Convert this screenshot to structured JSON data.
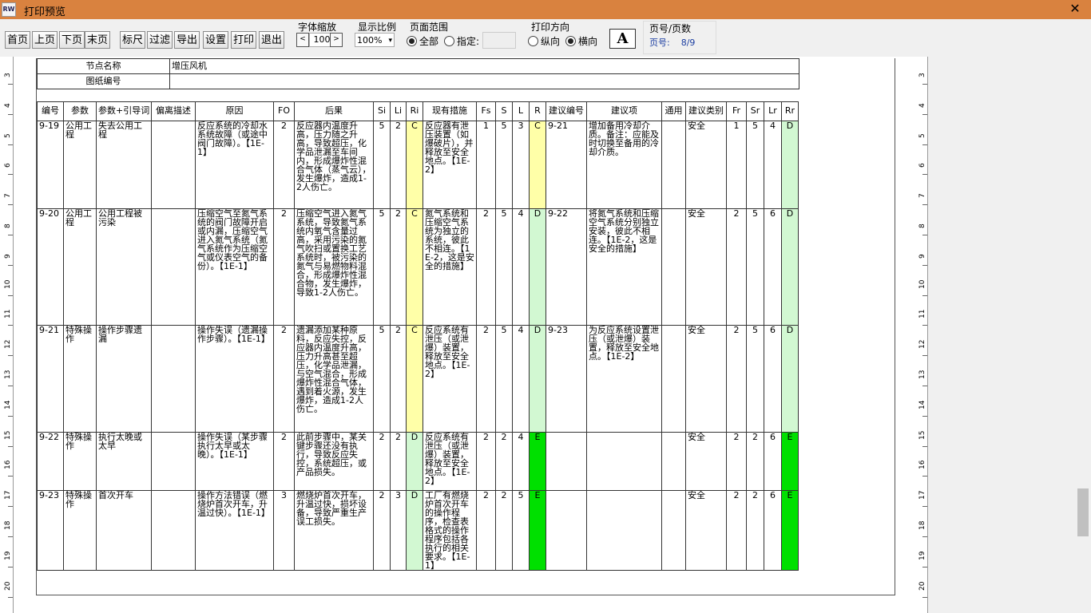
{
  "window": {
    "title": "打印预览",
    "icon": "preview-icon",
    "close": "✕"
  },
  "toolbar": {
    "nav": [
      "首页",
      "上页",
      "下页",
      "末页"
    ],
    "tools": [
      "标尺",
      "过滤",
      "导出",
      "设置",
      "打印",
      "退出"
    ],
    "font_zoom": {
      "label": "字体缩放",
      "value": "100",
      "dec": "<",
      "inc": ">"
    },
    "scale": {
      "label": "显示比例",
      "value": "100%"
    },
    "range": {
      "label": "页面范围",
      "all": "全部",
      "specify": "指定:"
    },
    "orientation": {
      "label": "打印方向",
      "portrait": "纵向",
      "landscape": "横向",
      "selected": "landscape"
    },
    "font_button": "A",
    "page": {
      "label": "页号/页数",
      "prefix": "页号:",
      "value": "8/9"
    }
  },
  "ruler": {
    "left_numbers": [
      "3",
      "4",
      "5",
      "6",
      "7",
      "8",
      "9",
      "10",
      "11",
      "12",
      "13",
      "14",
      "15",
      "16",
      "17",
      "18",
      "19",
      "20"
    ]
  },
  "header": [
    {
      "label": "节点名称",
      "value": "增压风机"
    },
    {
      "label": "图纸编号",
      "value": ""
    }
  ],
  "columns": [
    "编号",
    "参数",
    "参数+引导词",
    "偏离描述",
    "原因",
    "FO",
    "后果",
    "Si",
    "Li",
    "Ri",
    "现有措施",
    "Fs",
    "S",
    "L",
    "R",
    "建议编号",
    "建议项",
    "通用",
    "建议类别",
    "Fr",
    "Sr",
    "Lr",
    "Rr"
  ],
  "colors": {
    "yellow": "#ffffa8",
    "light_green": "#d2f8d2",
    "green": "#00e000"
  },
  "rows": [
    {
      "id": "9-19",
      "param": "公用工程",
      "guide": "失去公用工程",
      "dev": "",
      "cause": "反应系统的冷却水系统故障（或途中阀门故障）。【1E-1】",
      "fo": "2",
      "consequence": "反应器内温度升高，压力随之升高，导致超压，化学品泄漏至车间内，形成爆炸性混合气体（蒸气云），发生爆炸，造成1-2人伤亡。",
      "si": "5",
      "li": "2",
      "ri": "C",
      "measures": "反应器有泄压装置（如爆破片），并释放至安全地点。【1E-2】",
      "fs": "1",
      "s": "5",
      "l": "3",
      "r": "C",
      "sug_id": "9-21",
      "suggestion": "增加备用冷却介质。备注：应能及时切换至备用的冷却介质。",
      "general": "",
      "category": "安全",
      "fr": "1",
      "sr": "5",
      "lr": "4",
      "rr": "D"
    },
    {
      "id": "9-20",
      "param": "公用工程",
      "guide": "公用工程被污染",
      "dev": "",
      "cause": "压缩空气至氮气系统的阀门故障开启或内漏，压缩空气进入氮气系统（氮气系统作为压缩空气或仪表空气的备份）。【1E-1】",
      "fo": "2",
      "consequence": "压缩空气进入氮气系统，导致氮气系统内氧气含量过高，采用污染的氮气吹扫或置换工艺系统时，被污染的氮气与易燃物料混合，形成爆炸性混合物，发生爆炸，导致1-2人伤亡。",
      "si": "5",
      "li": "2",
      "ri": "C",
      "measures": "氮气系统和压缩空气系统为独立的系统，彼此不相连。【1E-2，这是安全的措施】",
      "fs": "2",
      "s": "5",
      "l": "4",
      "r": "D",
      "sug_id": "9-22",
      "suggestion": "将氮气系统和压缩空气系统分别独立安装，彼此不相连。【1E-2，这是安全的措施】",
      "general": "",
      "category": "安全",
      "fr": "2",
      "sr": "5",
      "lr": "6",
      "rr": "D"
    },
    {
      "id": "9-21",
      "param": "特殊操作",
      "guide": "操作步骤遗漏",
      "dev": "",
      "cause": "操作失误（遗漏操作步骤）。【1E-1】",
      "fo": "2",
      "consequence": "遗漏添加某种原料，反应失控，反应器内温度升高，压力升高甚至超压，化学品泄漏，与空气混合，形成爆炸性混合气体，遇到着火源，发生爆炸，造成1-2人伤亡。",
      "si": "5",
      "li": "2",
      "ri": "C",
      "measures": "反应系统有泄压（或泄爆）装置，释放至安全地点。【1E-2】",
      "fs": "2",
      "s": "5",
      "l": "4",
      "r": "D",
      "sug_id": "9-23",
      "suggestion": "为反应系统设置泄压（或泄爆）装置，释放至安全地点。【1E-2】",
      "general": "",
      "category": "安全",
      "fr": "2",
      "sr": "5",
      "lr": "6",
      "rr": "D"
    },
    {
      "id": "9-22",
      "param": "特殊操作",
      "guide": "执行太晚或太早",
      "dev": "",
      "cause": "操作失误（某步骤执行太早或太晚）。【1E-1】",
      "fo": "2",
      "consequence": "此前步骤中，某关键步骤还没有执行，导致反应失控，系统超压，或产品损失。",
      "si": "2",
      "li": "2",
      "ri": "D",
      "measures": "反应系统有泄压（或泄爆）装置，释放至安全地点。【1E-2】",
      "fs": "2",
      "s": "2",
      "l": "4",
      "r": "E",
      "sug_id": "",
      "suggestion": "",
      "general": "",
      "category": "安全",
      "fr": "2",
      "sr": "2",
      "lr": "6",
      "rr": "E"
    },
    {
      "id": "9-23",
      "param": "特殊操作",
      "guide": "首次开车",
      "dev": "",
      "cause": "操作方法错误（燃烧炉首次开车，升温过快）。【1E-1】",
      "fo": "3",
      "consequence": "燃烧炉首次开车，升温过快，损坏设备，导致严重生产误工损失。",
      "si": "2",
      "li": "3",
      "ri": "D",
      "measures": "工厂有燃烧炉首次开车的操作程序，检查表格式的操作程序包括各执行的相关要求。【1E-1】",
      "fs": "2",
      "s": "2",
      "l": "5",
      "r": "E",
      "sug_id": "",
      "suggestion": "",
      "general": "",
      "category": "安全",
      "fr": "2",
      "sr": "2",
      "lr": "6",
      "rr": "E"
    }
  ]
}
